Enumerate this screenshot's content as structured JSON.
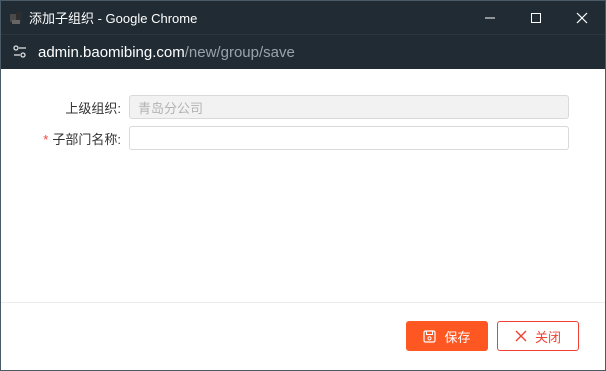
{
  "window": {
    "title": "添加子组织 - Google Chrome",
    "url_host": "admin.baomibing.com",
    "url_path": "/new/group/save"
  },
  "form": {
    "parent_label": "上级组织",
    "parent_value": "青岛分公司",
    "child_label": "子部门名称",
    "child_value": "",
    "required_mark": "*",
    "colon": ":"
  },
  "footer": {
    "save_label": "保存",
    "close_label": "关闭"
  },
  "colors": {
    "titlebar_bg": "#202b33",
    "primary": "#ff5722",
    "danger": "#f04134"
  }
}
